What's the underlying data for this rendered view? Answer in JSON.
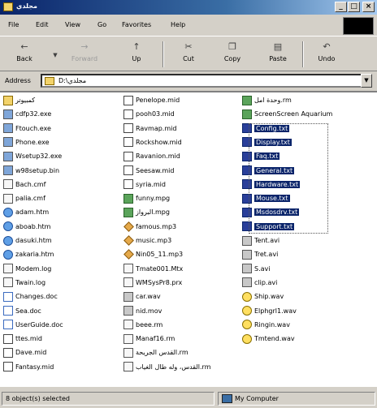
{
  "window": {
    "title": "مجلدي",
    "controls": {
      "minimize": "_",
      "maximize": "□",
      "close": "×"
    }
  },
  "menu": [
    "File",
    "Edit",
    "View",
    "Go",
    "Favorites",
    "Help"
  ],
  "toolbar": {
    "back": "Back",
    "forward": "Forward",
    "up": "Up",
    "cut": "Cut",
    "copy": "Copy",
    "paste": "Paste",
    "undo": "Undo"
  },
  "address": {
    "label": "Address",
    "value": "D:\\مجلدي"
  },
  "files": {
    "col1": [
      {
        "name": "كمبيوتر",
        "icon": "folder"
      },
      {
        "name": "cdfp32.exe",
        "icon": "exe"
      },
      {
        "name": "Ftouch.exe",
        "icon": "exe"
      },
      {
        "name": "Phone.exe",
        "icon": "exe"
      },
      {
        "name": "Wsetup32.exe",
        "icon": "exe"
      },
      {
        "name": "w98setup.bin",
        "icon": "exe"
      },
      {
        "name": "Bach.cmf",
        "icon": "txt"
      },
      {
        "name": "palia.cmf",
        "icon": "txt"
      },
      {
        "name": "adam.htm",
        "icon": "htm"
      },
      {
        "name": "aboab.htm",
        "icon": "htm"
      },
      {
        "name": "dasuki.htm",
        "icon": "htm"
      },
      {
        "name": "zakaria.htm",
        "icon": "htm"
      },
      {
        "name": "Modem.log",
        "icon": "txt"
      },
      {
        "name": "Twain.log",
        "icon": "txt"
      },
      {
        "name": "Changes.doc",
        "icon": "doc"
      },
      {
        "name": "Sea.doc",
        "icon": "doc"
      },
      {
        "name": "UserGuide.doc",
        "icon": "doc"
      },
      {
        "name": "ttes.mid",
        "icon": "mid"
      },
      {
        "name": "Dave.mid",
        "icon": "mid"
      },
      {
        "name": "Fantasy.mid",
        "icon": "mid"
      }
    ],
    "col2": [
      {
        "name": "Penelope.mid",
        "icon": "mid"
      },
      {
        "name": "pooh03.mid",
        "icon": "mid"
      },
      {
        "name": "Ravmap.mid",
        "icon": "mid"
      },
      {
        "name": "Rockshow.mid",
        "icon": "mid"
      },
      {
        "name": "Ravanion.mid",
        "icon": "mid"
      },
      {
        "name": "Seesaw.mid",
        "icon": "mid"
      },
      {
        "name": "syria.mid",
        "icon": "mid"
      },
      {
        "name": "funny.mpg",
        "icon": "img"
      },
      {
        "name": "البرواز.mpg",
        "icon": "img"
      },
      {
        "name": "famous.mp3",
        "icon": "mp3"
      },
      {
        "name": "music.mp3",
        "icon": "mp3"
      },
      {
        "name": "Nin05_11.mp3",
        "icon": "mp3"
      },
      {
        "name": "Tmate001.Mtx",
        "icon": "txt"
      },
      {
        "name": "WMSysPr8.prx",
        "icon": "txt"
      },
      {
        "name": "car.wav",
        "icon": "avi"
      },
      {
        "name": "nid.mov",
        "icon": "avi"
      },
      {
        "name": "beee.rm",
        "icon": "txt"
      },
      {
        "name": "Manaf16.rm",
        "icon": "txt"
      },
      {
        "name": "القدس الجريحة.rm",
        "icon": "txt"
      },
      {
        "name": "القدس، وله طال الغياب.rm",
        "icon": "txt"
      }
    ],
    "col3": [
      {
        "name": "وحدة امل.rm",
        "icon": "img"
      },
      {
        "name": "ScreenScreen Aquarium",
        "icon": "img"
      },
      {
        "name": "Config.txt",
        "icon": "sel",
        "selected": true
      },
      {
        "name": "Display.txt",
        "icon": "sel",
        "selected": true
      },
      {
        "name": "Faq.txt",
        "icon": "sel",
        "selected": true
      },
      {
        "name": "General.txt",
        "icon": "sel",
        "selected": true
      },
      {
        "name": "Hardware.txt",
        "icon": "sel",
        "selected": true
      },
      {
        "name": "Mouse.txt",
        "icon": "sel",
        "selected": true
      },
      {
        "name": "Msdosdrv.txt",
        "icon": "sel",
        "selected": true
      },
      {
        "name": "Support.txt",
        "icon": "sel",
        "selected": true
      },
      {
        "name": "Tent.avi",
        "icon": "avi"
      },
      {
        "name": "Tret.avi",
        "icon": "avi"
      },
      {
        "name": "S.avi",
        "icon": "avi"
      },
      {
        "name": "clip.avi",
        "icon": "avi"
      },
      {
        "name": "Ship.wav",
        "icon": "wav"
      },
      {
        "name": "Elphgrl1.wav",
        "icon": "wav"
      },
      {
        "name": "Ringin.wav",
        "icon": "wav"
      },
      {
        "name": "Tmtend.wav",
        "icon": "wav"
      }
    ]
  },
  "status": {
    "selection": "8 object(s) selected",
    "zone": "My Computer"
  }
}
